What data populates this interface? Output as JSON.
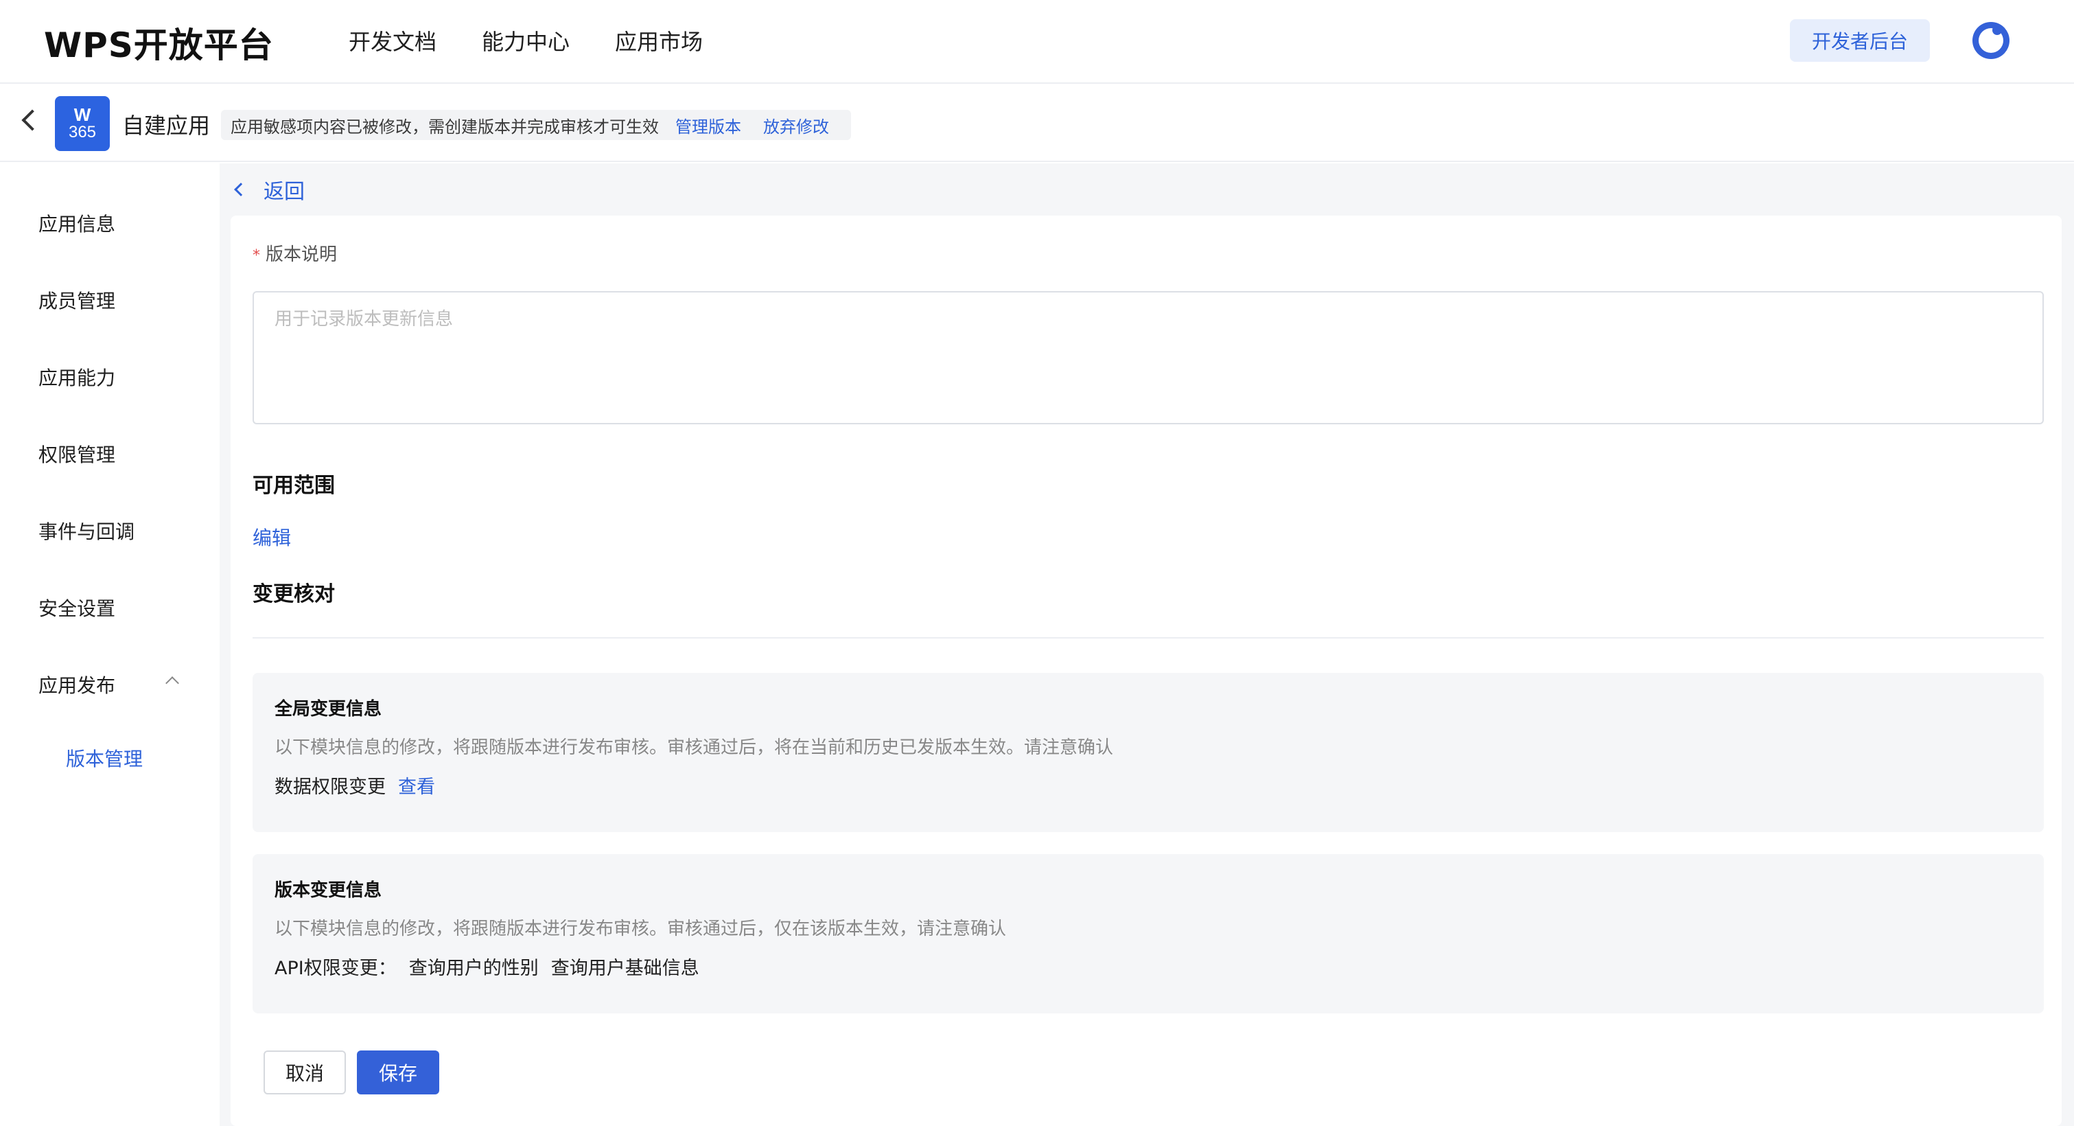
{
  "header": {
    "logo": "WPS开放平台",
    "nav": [
      "开发文档",
      "能力中心",
      "应用市场"
    ],
    "dev_button": "开发者后台"
  },
  "subheader": {
    "app_icon_top": "W",
    "app_icon_bottom": "365",
    "app_name": "自建应用",
    "notice_text": "应用敏感项内容已被修改，需创建版本并完成审核才可生效",
    "notice_link_manage": "管理版本",
    "notice_link_discard": "放弃修改"
  },
  "sidebar": {
    "items": [
      "应用信息",
      "成员管理",
      "应用能力",
      "权限管理",
      "事件与回调",
      "安全设置",
      "应用发布"
    ],
    "sub_item": "版本管理"
  },
  "main": {
    "back_label": "返回",
    "version_desc_label": "版本说明",
    "version_desc_placeholder": "用于记录版本更新信息",
    "scope_title": "可用范围",
    "edit_label": "编辑",
    "check_title": "变更核对",
    "global_card": {
      "title": "全局变更信息",
      "desc": "以下模块信息的修改，将跟随版本进行发布审核。审核通过后，将在当前和历史已发版本生效。请注意确认",
      "row_label": "数据权限变更",
      "row_link": "查看"
    },
    "version_card": {
      "title": "版本变更信息",
      "desc": "以下模块信息的修改，将跟随版本进行发布审核。审核通过后，仅在该版本生效，请注意确认",
      "row_label": "API权限变更：",
      "row_items": [
        "查询用户的性别",
        "查询用户基础信息"
      ]
    },
    "cancel_button": "取消",
    "save_button": "保存"
  }
}
